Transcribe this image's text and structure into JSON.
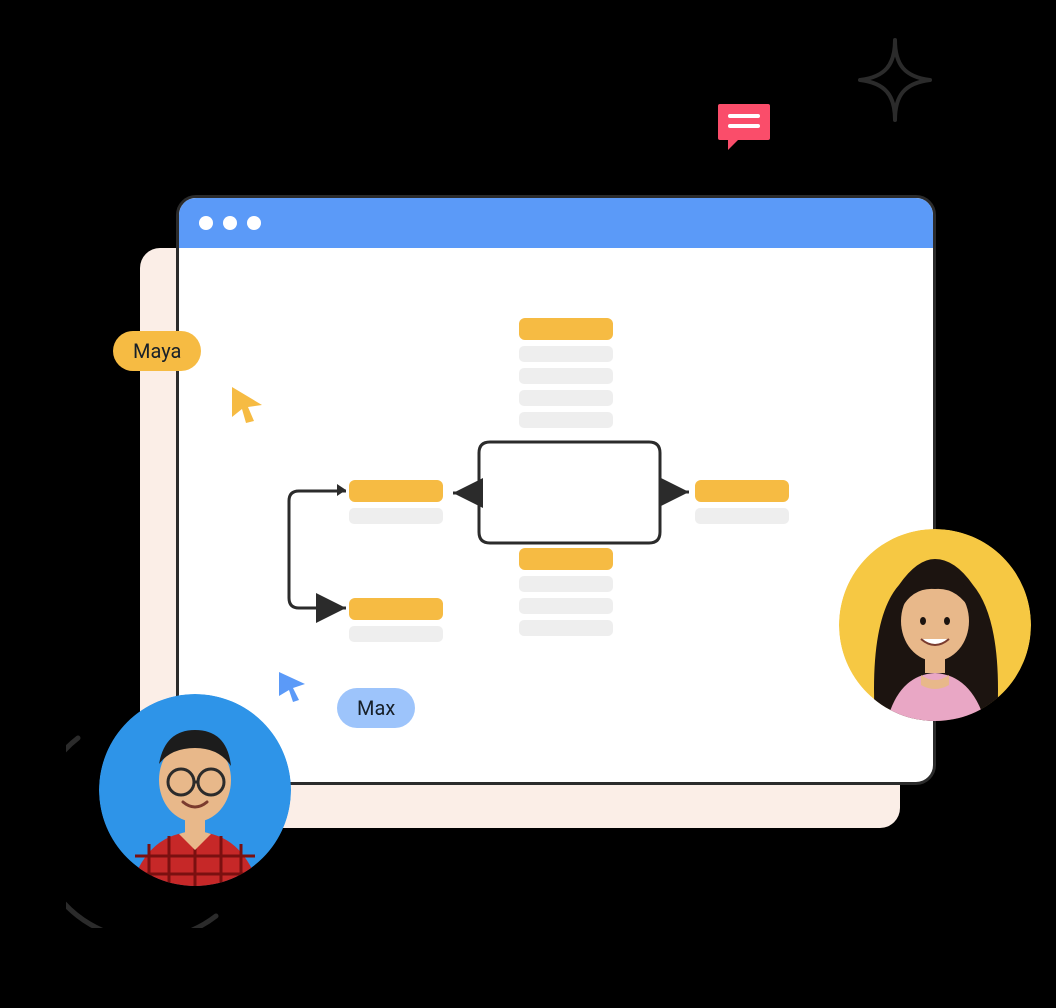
{
  "users": {
    "user1": {
      "name": "Maya"
    },
    "user2": {
      "name": "Max"
    }
  },
  "colors": {
    "accent_blue": "#5B9AF8",
    "accent_orange": "#F6BB43",
    "avatar1_bg": "#2E94E8",
    "avatar2_bg": "#F6C843",
    "chat_bubble": "#FA4D6A",
    "outline": "#2B2B2B"
  },
  "diagram": {
    "nodes": [
      {
        "id": "top",
        "yellow": 1,
        "grey": 4
      },
      {
        "id": "left1",
        "yellow": 1,
        "grey": 1
      },
      {
        "id": "left2",
        "yellow": 1,
        "grey": 1
      },
      {
        "id": "right",
        "yellow": 1,
        "grey": 1
      },
      {
        "id": "bottom",
        "yellow": 1,
        "grey": 3
      }
    ],
    "connections": [
      [
        "left1",
        "left2",
        "bidirectional-loop"
      ],
      [
        "top",
        "left1",
        "right-to-left"
      ],
      [
        "top-bottom-midline",
        "right",
        "left-to-right"
      ],
      [
        "top",
        "bottom",
        "vertical"
      ]
    ]
  }
}
